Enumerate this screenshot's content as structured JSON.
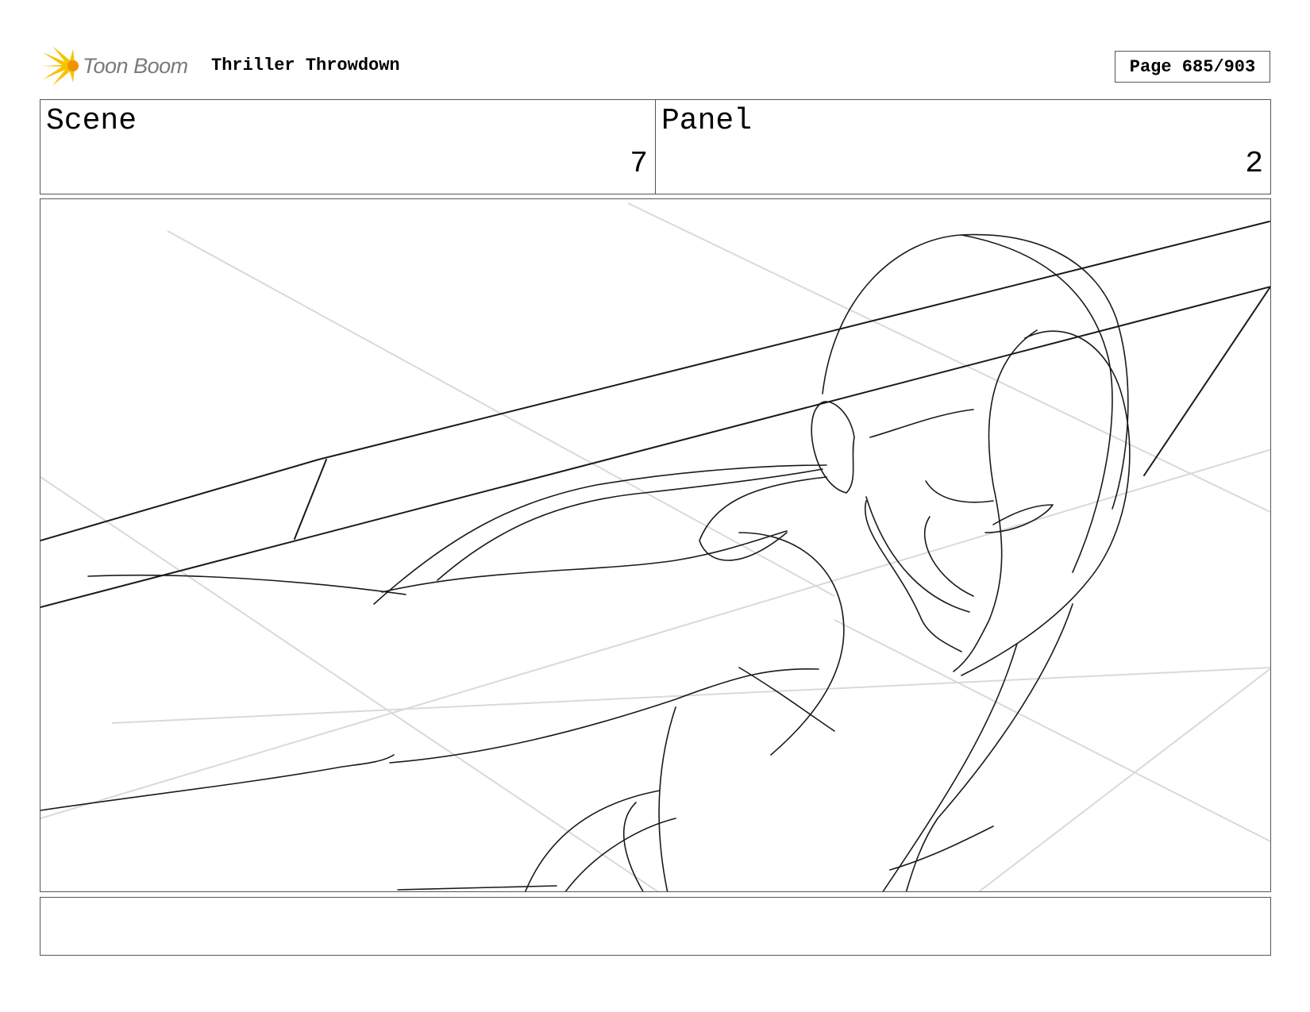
{
  "header": {
    "brand": "Toon Boom",
    "project_title": "Thriller Throwdown",
    "page_indicator": "Page 685/903"
  },
  "info": {
    "scene_label": "Scene",
    "scene_value": "7",
    "panel_label": "Panel",
    "panel_value": "2"
  },
  "notes": {
    "text": ""
  },
  "colors": {
    "logo_yellow": "#f5c400",
    "logo_orange": "#f39200",
    "brand_gray": "#7a7a7a",
    "border": "#555555",
    "sketch": "#1a1a1a",
    "guide": "#d6d6d6"
  },
  "icons": {
    "logo": "toon-boom-starburst-icon"
  }
}
